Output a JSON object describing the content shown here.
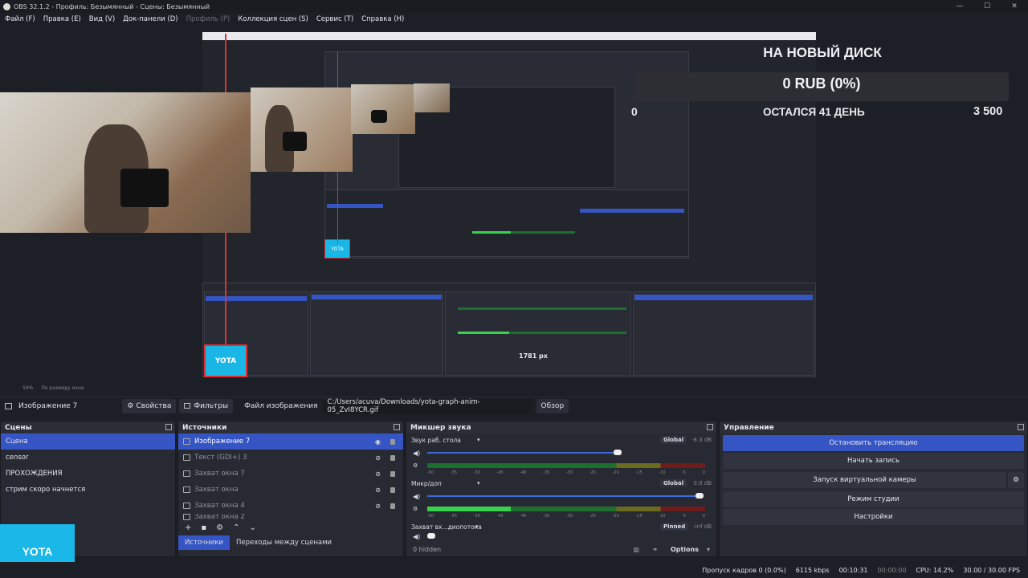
{
  "titlebar": {
    "title": "OBS 32.1.2 - Профиль: Безымянный - Сцены: Безымянный",
    "min": "—",
    "max": "☐",
    "close": "✕"
  },
  "menu": [
    "Файл (F)",
    "Правка (E)",
    "Вид (V)",
    "Док-панели (D)",
    "Профиль (P)",
    "Коллекция сцен (S)",
    "Сервис (T)",
    "Справка (H)"
  ],
  "overlay": {
    "title": "НА НОВЫЙ ДИСК",
    "value": "0 RUB (0%)",
    "min": "0",
    "remaining": "ОСТАЛСЯ 41 ДЕНЬ",
    "max": "3 500"
  },
  "nested": {
    "size_label": "1781 px",
    "yota": "YOTA"
  },
  "zoom": {
    "value": "59%",
    "fit": "По размеру окна"
  },
  "props": {
    "source": "Изображение 7",
    "properties": "Свойства",
    "filters": "Фильтры",
    "file_label": "Файл изображения",
    "path": "C:/Users/acuva/Downloads/yota-graph-anim-05_ZvI8YCR.gif",
    "browse": "Обзор"
  },
  "scenes": {
    "title": "Сцены",
    "items": [
      "Сцена",
      "censor",
      "ПРОХОЖДЕНИЯ",
      "стрим скоро начнется"
    ]
  },
  "sources": {
    "title": "Источники",
    "items": [
      "Изображение 7",
      "Текст (GDI+) 3",
      "Захват окна 7",
      "Захват окна",
      "Захват окна 4",
      "Захват окна 2"
    ],
    "tab1": "Источники",
    "tab2": "Переходы между сценами"
  },
  "mixer": {
    "title": "Микшер звука",
    "channels": [
      {
        "name": "Звук раб. стола",
        "tag": "Global",
        "db": "-8.3 dB",
        "level": 0,
        "volume": 0.72
      },
      {
        "name": "Микр/доп",
        "tag": "Global",
        "db": "0.0 dB",
        "level": 0.3,
        "volume": 1.0
      },
      {
        "name": "Захват вх...диопотока",
        "tag": "Pinned",
        "db": "-inf dB",
        "level": 0,
        "volume": 0.0
      }
    ],
    "hidden": "0 hidden",
    "options": "Options",
    "scale": [
      "-60",
      "-55",
      "-50",
      "-45",
      "-40",
      "-35",
      "-30",
      "-25",
      "-20",
      "-15",
      "-10",
      "-5",
      "0"
    ]
  },
  "controls": {
    "title": "Управление",
    "buttons": [
      "Остановить трансляцию",
      "Начать запись",
      "Запуск виртуальной камеры",
      "Режим студии",
      "Настройки"
    ]
  },
  "status": {
    "dropped": "Пропуск кадров 0 (0.0%)",
    "bitrate": "6115 kbps",
    "stream_time": "00:10:31",
    "rec_time": "00:00:00",
    "cpu": "CPU: 14.2%",
    "fps": "30.00 / 30.00 FPS"
  },
  "yota_logo": "YOTA",
  "colors": {
    "accent": "#3655c4",
    "live": "#e03030",
    "yota": "#19b8e8"
  }
}
